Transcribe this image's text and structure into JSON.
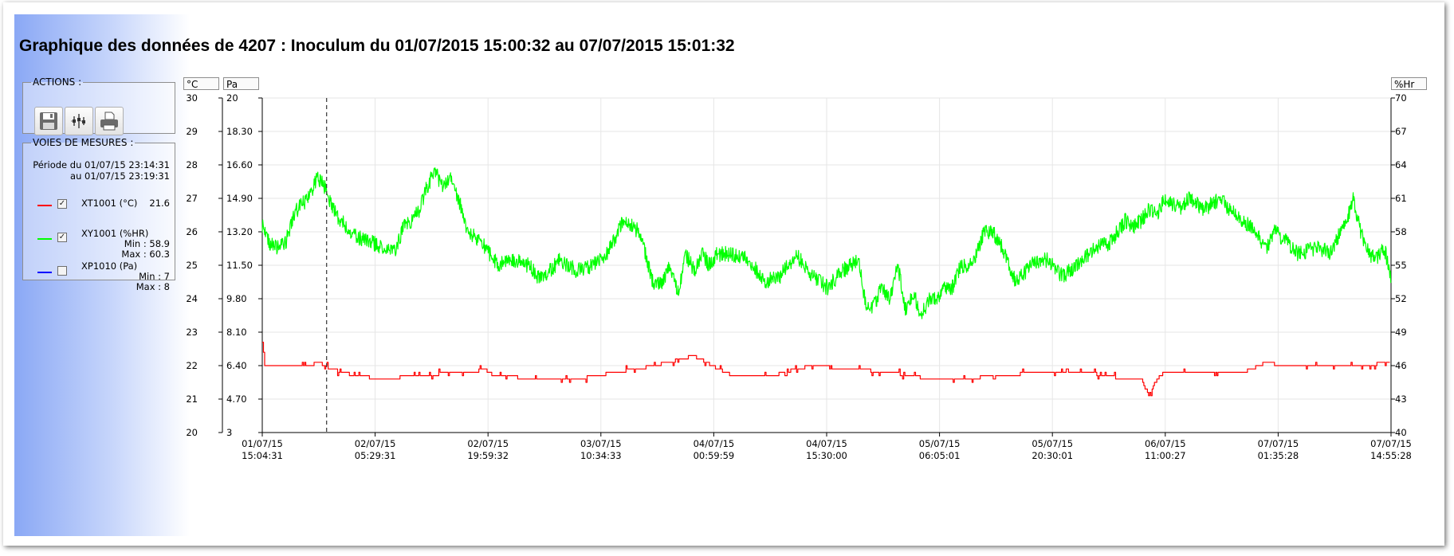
{
  "page": {
    "title": "Graphique des données de 4207 : Inoculum du 01/07/2015 15:00:32 au 07/07/2015 15:01:32"
  },
  "actions": {
    "legend": "ACTIONS :",
    "buttons": [
      {
        "icon": "save-icon"
      },
      {
        "icon": "graph-points-icon"
      },
      {
        "icon": "print-icon"
      }
    ]
  },
  "voies": {
    "legend": "VOIES DE MESURES :",
    "periode_line1": "Période du 01/07/15 23:14:31",
    "periode_line2": "au 01/07/15 23:19:31",
    "channels": [
      {
        "name": "XT1001 (°C)",
        "value": "21.6",
        "min": "",
        "max": "",
        "color": "#ff0000",
        "checked": true
      },
      {
        "name": "XY1001 (%HR)",
        "value": "",
        "min": "Min : 58.9",
        "max": "Max : 60.3",
        "color": "#00ff00",
        "checked": true
      },
      {
        "name": "XP1010 (Pa)",
        "value": "",
        "min": "Min : 7",
        "max": "Max : 8",
        "color": "#0000ff",
        "checked": false
      }
    ]
  },
  "chart_data": {
    "type": "line",
    "title": "",
    "grid": true,
    "axes": {
      "left1": {
        "unit": "°C",
        "range": [
          20,
          30
        ],
        "ticks": [
          "20",
          "21",
          "22",
          "23",
          "24",
          "25",
          "26",
          "27",
          "28",
          "29",
          "30"
        ]
      },
      "left2": {
        "unit": "Pa",
        "range": [
          3,
          20
        ],
        "ticks": [
          "3",
          "4.70",
          "6.40",
          "8.10",
          "9.80",
          "11.50",
          "13.20",
          "14.90",
          "16.60",
          "18.30",
          "20"
        ]
      },
      "right": {
        "unit": "%Hr",
        "range": [
          40,
          70
        ],
        "ticks": [
          "40",
          "43",
          "46",
          "49",
          "52",
          "55",
          "58",
          "61",
          "64",
          "67",
          "70"
        ]
      }
    },
    "x_ticks": [
      {
        "date": "01/07/15",
        "time": "15:04:31"
      },
      {
        "date": "02/07/15",
        "time": "05:29:31"
      },
      {
        "date": "02/07/15",
        "time": "19:59:32"
      },
      {
        "date": "03/07/15",
        "time": "10:34:33"
      },
      {
        "date": "04/07/15",
        "time": "00:59:59"
      },
      {
        "date": "04/07/15",
        "time": "15:30:00"
      },
      {
        "date": "05/07/15",
        "time": "06:05:01"
      },
      {
        "date": "05/07/15",
        "time": "20:30:01"
      },
      {
        "date": "06/07/15",
        "time": "11:00:27"
      },
      {
        "date": "07/07/15",
        "time": "01:35:28"
      },
      {
        "date": "07/07/15",
        "time": "14:55:28"
      }
    ],
    "cursor_hours": 8.2,
    "x_range_hours": [
      0,
      143.85
    ],
    "series": [
      {
        "name": "XT1001 (°C)",
        "axis": "left1",
        "color": "#ff0000",
        "x": [
          0,
          0.3,
          1,
          3,
          5,
          6,
          7,
          8,
          9,
          10,
          12,
          15,
          20,
          25,
          27,
          28,
          30,
          35,
          40,
          45,
          50,
          55,
          58,
          60,
          63,
          65,
          68,
          70,
          75,
          80,
          85,
          90,
          93,
          95,
          98,
          100,
          105,
          110,
          112,
          113,
          114,
          115,
          120,
          125,
          128,
          130,
          133,
          135,
          140,
          143.85
        ],
        "y": [
          22.8,
          22.0,
          22.0,
          22.0,
          22.0,
          22.0,
          22.1,
          22.0,
          21.9,
          21.8,
          21.7,
          21.6,
          21.7,
          21.8,
          21.8,
          21.9,
          21.7,
          21.6,
          21.6,
          21.8,
          22.0,
          22.3,
          21.9,
          21.7,
          21.7,
          21.7,
          21.9,
          22.0,
          21.9,
          21.8,
          21.6,
          21.6,
          21.7,
          21.7,
          21.8,
          21.8,
          21.8,
          21.6,
          21.6,
          21.1,
          21.6,
          21.8,
          21.8,
          21.8,
          22.1,
          22.0,
          22.0,
          22.0,
          22.0,
          22.1
        ]
      },
      {
        "name": "XY1001 (%HR)",
        "axis": "right",
        "color": "#00ff00",
        "x": [
          0,
          1,
          2,
          3,
          4,
          5,
          6,
          7,
          8,
          9,
          10,
          12,
          14,
          16,
          17,
          18,
          19,
          20,
          21,
          22,
          23,
          24,
          25,
          26,
          27,
          28,
          30,
          32,
          34,
          35,
          36,
          38,
          40,
          42,
          44,
          46,
          48,
          50,
          51,
          52,
          53,
          54,
          55,
          56,
          57,
          58,
          59,
          60,
          62,
          64,
          66,
          68,
          70,
          72,
          74,
          76,
          77,
          78,
          79,
          80,
          81,
          82,
          83,
          84,
          85,
          86,
          87,
          88,
          89,
          90,
          91,
          92,
          93,
          94,
          96,
          98,
          100,
          102,
          104,
          106,
          108,
          109,
          110,
          111,
          112,
          113,
          114,
          115,
          116,
          117,
          118,
          120,
          122,
          124,
          126,
          128,
          129,
          130,
          132,
          134,
          135,
          136,
          137,
          138,
          139,
          140,
          141,
          142,
          143,
          143.85
        ],
        "y": [
          58.5,
          57,
          56.5,
          57,
          59.5,
          60.5,
          61,
          63,
          62,
          60,
          59,
          57.5,
          57,
          56.5,
          56.5,
          58.5,
          59,
          60,
          62,
          63.5,
          62,
          63,
          61,
          58.5,
          57.5,
          57,
          55,
          55.5,
          55,
          54,
          54,
          55.5,
          54.5,
          55,
          56,
          59,
          58,
          53,
          53.5,
          55,
          52.5,
          56,
          54.5,
          56,
          55,
          56,
          56,
          56,
          55.5,
          53.5,
          54,
          56,
          54,
          53,
          54.5,
          55.5,
          51,
          51.5,
          53,
          52,
          55,
          51,
          52.5,
          50.5,
          52,
          52,
          53,
          53,
          55,
          55,
          56,
          58,
          58,
          57,
          53.5,
          55,
          55.5,
          54,
          55,
          56.5,
          57,
          58,
          59,
          58.5,
          59,
          60,
          59.5,
          61,
          60.5,
          60,
          61,
          60,
          61,
          59.5,
          58.5,
          56.5,
          58,
          57.5,
          56,
          56.5,
          56.5,
          56,
          57.5,
          58.5,
          61,
          58,
          56,
          55.5,
          56.5,
          54
        ]
      },
      {
        "name": "XP1010 (Pa)",
        "axis": "left2",
        "color": "#0000ff",
        "visible": false,
        "x": [],
        "y": []
      }
    ]
  }
}
